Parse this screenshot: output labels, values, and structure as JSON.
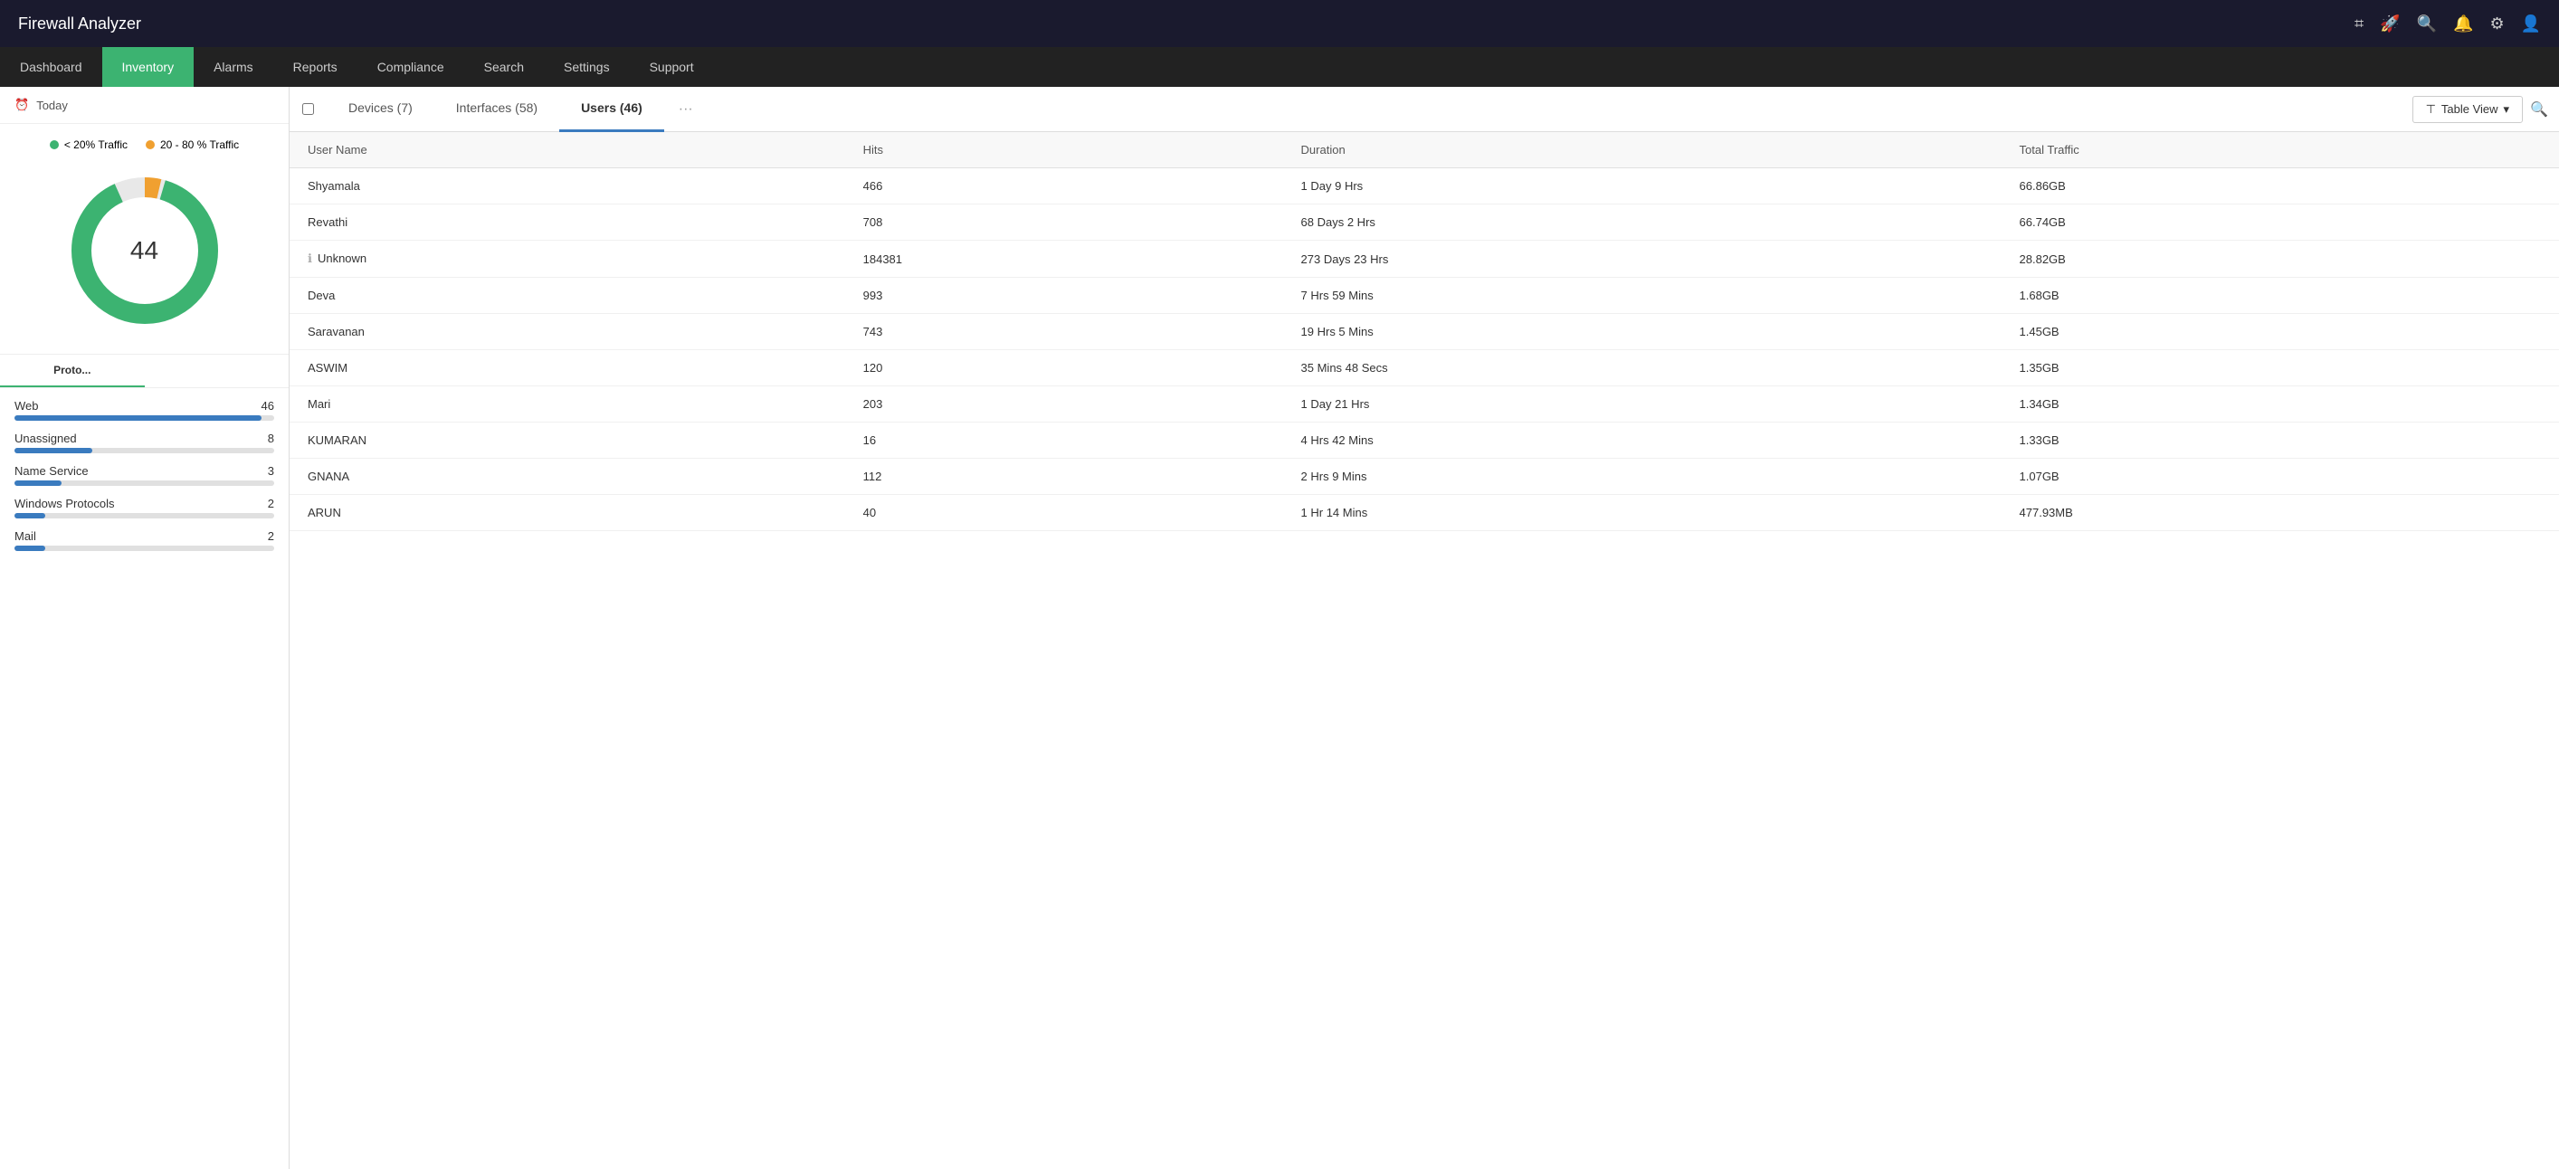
{
  "app": {
    "title": "Firewall Analyzer"
  },
  "topbar": {
    "icons": [
      "monitor-icon",
      "rocket-icon",
      "search-icon",
      "bell-icon",
      "gear-icon",
      "user-icon"
    ]
  },
  "navbar": {
    "items": [
      {
        "label": "Dashboard",
        "active": false
      },
      {
        "label": "Inventory",
        "active": true
      },
      {
        "label": "Alarms",
        "active": false
      },
      {
        "label": "Reports",
        "active": false
      },
      {
        "label": "Compliance",
        "active": false
      },
      {
        "label": "Search",
        "active": false
      },
      {
        "label": "Settings",
        "active": false
      },
      {
        "label": "Support",
        "active": false
      }
    ]
  },
  "sidebar": {
    "period_icon": "clock-icon",
    "period_label": "Today",
    "donut_value": "44",
    "legend": [
      {
        "label": "< 20% Traffic",
        "color": "#3cb371"
      },
      {
        "label": "20 - 80 % Traffic",
        "color": "#f0a030"
      }
    ],
    "protocol_tabs": [
      {
        "label": "Proto...",
        "active": true
      },
      {
        "label": "",
        "active": false
      }
    ],
    "protocols": [
      {
        "name": "Web",
        "count": 46,
        "bar_pct": 95
      },
      {
        "name": "Unassigned",
        "count": 8,
        "bar_pct": 30
      },
      {
        "name": "Name Service",
        "count": 3,
        "bar_pct": 18
      },
      {
        "name": "Windows Protocols",
        "count": 2,
        "bar_pct": 12
      },
      {
        "name": "Mail",
        "count": 2,
        "bar_pct": 12
      }
    ]
  },
  "tabs": [
    {
      "label": "Devices (7)",
      "active": false
    },
    {
      "label": "Interfaces (58)",
      "active": false
    },
    {
      "label": "Users (46)",
      "active": true
    },
    {
      "label": "···",
      "active": false
    }
  ],
  "table_view_label": "Table View",
  "columns": [
    "User Name",
    "Hits",
    "Duration",
    "Total Traffic"
  ],
  "rows": [
    {
      "name": "Shyamala",
      "hits": "466",
      "duration": "1 Day 9 Hrs",
      "traffic": "66.86GB",
      "info": false
    },
    {
      "name": "Revathi",
      "hits": "708",
      "duration": "68 Days 2 Hrs",
      "traffic": "66.74GB",
      "info": false
    },
    {
      "name": "Unknown",
      "hits": "184381",
      "duration": "273 Days 23 Hrs",
      "traffic": "28.82GB",
      "info": true
    },
    {
      "name": "Deva",
      "hits": "993",
      "duration": "7 Hrs 59 Mins",
      "traffic": "1.68GB",
      "info": false
    },
    {
      "name": "Saravanan",
      "hits": "743",
      "duration": "19 Hrs 5 Mins",
      "traffic": "1.45GB",
      "info": false
    },
    {
      "name": "ASWIM",
      "hits": "120",
      "duration": "35 Mins 48 Secs",
      "traffic": "1.35GB",
      "info": false
    },
    {
      "name": "Mari",
      "hits": "203",
      "duration": "1 Day 21 Hrs",
      "traffic": "1.34GB",
      "info": false
    },
    {
      "name": "KUMARAN",
      "hits": "16",
      "duration": "4 Hrs 42 Mins",
      "traffic": "1.33GB",
      "info": false
    },
    {
      "name": "GNANA",
      "hits": "112",
      "duration": "2 Hrs 9 Mins",
      "traffic": "1.07GB",
      "info": false
    },
    {
      "name": "ARUN",
      "hits": "40",
      "duration": "1 Hr 14 Mins",
      "traffic": "477.93MB",
      "info": false
    }
  ]
}
